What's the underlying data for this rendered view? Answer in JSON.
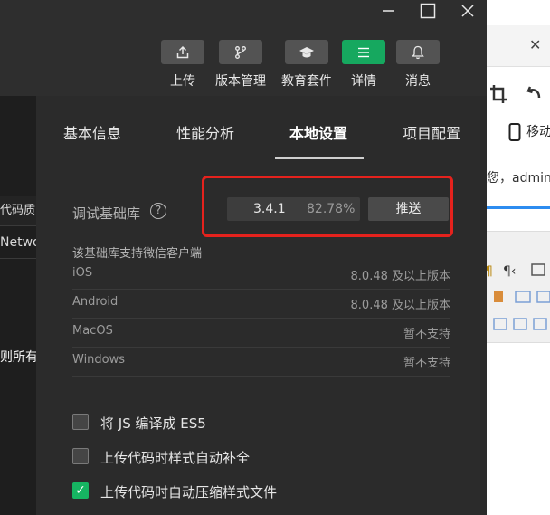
{
  "window_controls": {
    "minimize_icon": "minimize-icon",
    "maximize_icon": "maximize-icon",
    "close_icon": "close-icon"
  },
  "toolbar": [
    {
      "label": "上传",
      "icon": "upload-icon",
      "active": false
    },
    {
      "label": "版本管理",
      "icon": "branch-icon",
      "active": false
    },
    {
      "label": "教育套件",
      "icon": "graduation-cap-icon",
      "active": false
    },
    {
      "label": "详情",
      "icon": "menu-lines-icon",
      "active": true
    },
    {
      "label": "消息",
      "icon": "bell-icon",
      "active": false
    }
  ],
  "left_strip": {
    "item1": "代码质",
    "item2": "Netwo",
    "text3": "则所有"
  },
  "tabs": [
    {
      "label": "基本信息",
      "active": false
    },
    {
      "label": "性能分析",
      "active": false
    },
    {
      "label": "本地设置",
      "active": true
    },
    {
      "label": "项目配置",
      "active": false
    }
  ],
  "debug_lib": {
    "label": "调试基础库",
    "help_icon": "question-circle-icon",
    "version": "3.4.1",
    "percent": "82.78%",
    "push_label": "推送"
  },
  "support": {
    "title": "该基础库支持微信客户端",
    "rows": [
      {
        "os": "iOS",
        "status": "8.0.48 及以上版本"
      },
      {
        "os": "Android",
        "status": "8.0.48 及以上版本"
      },
      {
        "os": "MacOS",
        "status": "暂不支持"
      },
      {
        "os": "Windows",
        "status": "暂不支持"
      }
    ]
  },
  "options": [
    {
      "label": "将 JS 编译成 ES5",
      "checked": false
    },
    {
      "label": "上传代码时样式自动补全",
      "checked": false
    },
    {
      "label": "上传代码时自动压缩样式文件",
      "checked": true
    }
  ],
  "right_window": {
    "close_glyph": "✕",
    "move_label": "移动",
    "greeting": "您，admin"
  },
  "colors": {
    "accent_green": "#16a85f",
    "highlight_red": "#e5221d",
    "link_blue": "#2d8cf0"
  }
}
